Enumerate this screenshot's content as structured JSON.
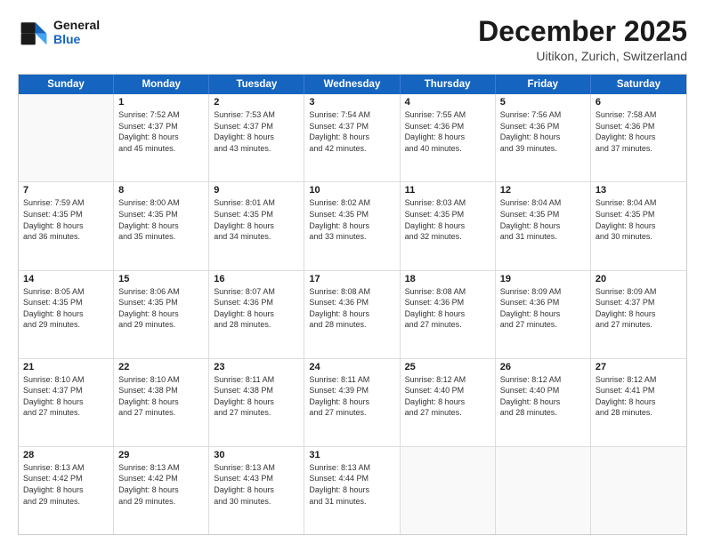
{
  "header": {
    "logo_line1": "General",
    "logo_line2": "Blue",
    "month": "December 2025",
    "location": "Uitikon, Zurich, Switzerland"
  },
  "weekdays": [
    "Sunday",
    "Monday",
    "Tuesday",
    "Wednesday",
    "Thursday",
    "Friday",
    "Saturday"
  ],
  "rows": [
    [
      {
        "day": "",
        "empty": true
      },
      {
        "day": "1",
        "lines": [
          "Sunrise: 7:52 AM",
          "Sunset: 4:37 PM",
          "Daylight: 8 hours",
          "and 45 minutes."
        ]
      },
      {
        "day": "2",
        "lines": [
          "Sunrise: 7:53 AM",
          "Sunset: 4:37 PM",
          "Daylight: 8 hours",
          "and 43 minutes."
        ]
      },
      {
        "day": "3",
        "lines": [
          "Sunrise: 7:54 AM",
          "Sunset: 4:37 PM",
          "Daylight: 8 hours",
          "and 42 minutes."
        ]
      },
      {
        "day": "4",
        "lines": [
          "Sunrise: 7:55 AM",
          "Sunset: 4:36 PM",
          "Daylight: 8 hours",
          "and 40 minutes."
        ]
      },
      {
        "day": "5",
        "lines": [
          "Sunrise: 7:56 AM",
          "Sunset: 4:36 PM",
          "Daylight: 8 hours",
          "and 39 minutes."
        ]
      },
      {
        "day": "6",
        "lines": [
          "Sunrise: 7:58 AM",
          "Sunset: 4:36 PM",
          "Daylight: 8 hours",
          "and 37 minutes."
        ]
      }
    ],
    [
      {
        "day": "7",
        "lines": [
          "Sunrise: 7:59 AM",
          "Sunset: 4:35 PM",
          "Daylight: 8 hours",
          "and 36 minutes."
        ]
      },
      {
        "day": "8",
        "lines": [
          "Sunrise: 8:00 AM",
          "Sunset: 4:35 PM",
          "Daylight: 8 hours",
          "and 35 minutes."
        ]
      },
      {
        "day": "9",
        "lines": [
          "Sunrise: 8:01 AM",
          "Sunset: 4:35 PM",
          "Daylight: 8 hours",
          "and 34 minutes."
        ]
      },
      {
        "day": "10",
        "lines": [
          "Sunrise: 8:02 AM",
          "Sunset: 4:35 PM",
          "Daylight: 8 hours",
          "and 33 minutes."
        ]
      },
      {
        "day": "11",
        "lines": [
          "Sunrise: 8:03 AM",
          "Sunset: 4:35 PM",
          "Daylight: 8 hours",
          "and 32 minutes."
        ]
      },
      {
        "day": "12",
        "lines": [
          "Sunrise: 8:04 AM",
          "Sunset: 4:35 PM",
          "Daylight: 8 hours",
          "and 31 minutes."
        ]
      },
      {
        "day": "13",
        "lines": [
          "Sunrise: 8:04 AM",
          "Sunset: 4:35 PM",
          "Daylight: 8 hours",
          "and 30 minutes."
        ]
      }
    ],
    [
      {
        "day": "14",
        "lines": [
          "Sunrise: 8:05 AM",
          "Sunset: 4:35 PM",
          "Daylight: 8 hours",
          "and 29 minutes."
        ]
      },
      {
        "day": "15",
        "lines": [
          "Sunrise: 8:06 AM",
          "Sunset: 4:35 PM",
          "Daylight: 8 hours",
          "and 29 minutes."
        ]
      },
      {
        "day": "16",
        "lines": [
          "Sunrise: 8:07 AM",
          "Sunset: 4:36 PM",
          "Daylight: 8 hours",
          "and 28 minutes."
        ]
      },
      {
        "day": "17",
        "lines": [
          "Sunrise: 8:08 AM",
          "Sunset: 4:36 PM",
          "Daylight: 8 hours",
          "and 28 minutes."
        ]
      },
      {
        "day": "18",
        "lines": [
          "Sunrise: 8:08 AM",
          "Sunset: 4:36 PM",
          "Daylight: 8 hours",
          "and 27 minutes."
        ]
      },
      {
        "day": "19",
        "lines": [
          "Sunrise: 8:09 AM",
          "Sunset: 4:36 PM",
          "Daylight: 8 hours",
          "and 27 minutes."
        ]
      },
      {
        "day": "20",
        "lines": [
          "Sunrise: 8:09 AM",
          "Sunset: 4:37 PM",
          "Daylight: 8 hours",
          "and 27 minutes."
        ]
      }
    ],
    [
      {
        "day": "21",
        "lines": [
          "Sunrise: 8:10 AM",
          "Sunset: 4:37 PM",
          "Daylight: 8 hours",
          "and 27 minutes."
        ]
      },
      {
        "day": "22",
        "lines": [
          "Sunrise: 8:10 AM",
          "Sunset: 4:38 PM",
          "Daylight: 8 hours",
          "and 27 minutes."
        ]
      },
      {
        "day": "23",
        "lines": [
          "Sunrise: 8:11 AM",
          "Sunset: 4:38 PM",
          "Daylight: 8 hours",
          "and 27 minutes."
        ]
      },
      {
        "day": "24",
        "lines": [
          "Sunrise: 8:11 AM",
          "Sunset: 4:39 PM",
          "Daylight: 8 hours",
          "and 27 minutes."
        ]
      },
      {
        "day": "25",
        "lines": [
          "Sunrise: 8:12 AM",
          "Sunset: 4:40 PM",
          "Daylight: 8 hours",
          "and 27 minutes."
        ]
      },
      {
        "day": "26",
        "lines": [
          "Sunrise: 8:12 AM",
          "Sunset: 4:40 PM",
          "Daylight: 8 hours",
          "and 28 minutes."
        ]
      },
      {
        "day": "27",
        "lines": [
          "Sunrise: 8:12 AM",
          "Sunset: 4:41 PM",
          "Daylight: 8 hours",
          "and 28 minutes."
        ]
      }
    ],
    [
      {
        "day": "28",
        "lines": [
          "Sunrise: 8:13 AM",
          "Sunset: 4:42 PM",
          "Daylight: 8 hours",
          "and 29 minutes."
        ]
      },
      {
        "day": "29",
        "lines": [
          "Sunrise: 8:13 AM",
          "Sunset: 4:42 PM",
          "Daylight: 8 hours",
          "and 29 minutes."
        ]
      },
      {
        "day": "30",
        "lines": [
          "Sunrise: 8:13 AM",
          "Sunset: 4:43 PM",
          "Daylight: 8 hours",
          "and 30 minutes."
        ]
      },
      {
        "day": "31",
        "lines": [
          "Sunrise: 8:13 AM",
          "Sunset: 4:44 PM",
          "Daylight: 8 hours",
          "and 31 minutes."
        ]
      },
      {
        "day": "",
        "empty": true
      },
      {
        "day": "",
        "empty": true
      },
      {
        "day": "",
        "empty": true
      }
    ]
  ]
}
